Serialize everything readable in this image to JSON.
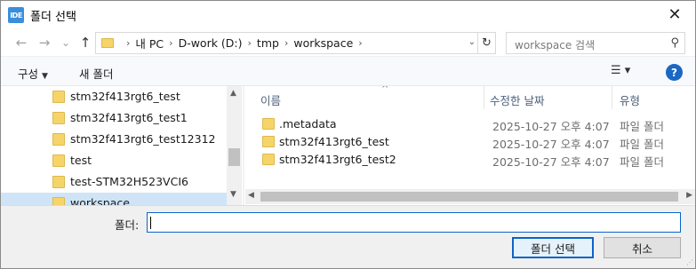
{
  "app": {
    "icon_text": "IDE",
    "title": "폴더 선택",
    "close_glyph": "✕"
  },
  "nav": {
    "back_glyph": "←",
    "forward_glyph": "→",
    "history_glyph": "⌄",
    "up_glyph": "↑",
    "breadcrumbs": [
      "내 PC",
      "D-work (D:)",
      "tmp",
      "workspace"
    ],
    "breadcrumb_sep": "›",
    "dropdown_glyph": "⌄",
    "refresh_glyph": "↻",
    "search_placeholder": "workspace 검색",
    "search_glyph": "⚲"
  },
  "toolbar": {
    "organize_label": "구성",
    "organize_caret": "▼",
    "new_folder_label": "새 폴더",
    "view_glyph": "☰ ▾",
    "help_glyph": "?"
  },
  "tree": {
    "items": [
      {
        "label": "stm32f413rgt6_test"
      },
      {
        "label": "stm32f413rgt6_test1"
      },
      {
        "label": "stm32f413rgt6_test12312"
      },
      {
        "label": "test"
      },
      {
        "label": "test-STM32H523VCI6"
      },
      {
        "label": "workspace",
        "selected": true
      }
    ],
    "scroll_up_glyph": "▲",
    "scroll_down_glyph": "▼"
  },
  "list": {
    "columns": {
      "name": "이름",
      "date": "수정한 날짜",
      "type": "유형"
    },
    "sort_glyph": "^",
    "rows": [
      {
        "name": ".metadata",
        "date": "2025-10-27 오후 4:07",
        "type": "파일 폴더"
      },
      {
        "name": "stm32f413rgt6_test",
        "date": "2025-10-27 오후 4:07",
        "type": "파일 폴더"
      },
      {
        "name": "stm32f413rgt6_test2",
        "date": "2025-10-27 오후 4:07",
        "type": "파일 폴더"
      }
    ],
    "scroll_left_glyph": "◀",
    "scroll_right_glyph": "▶"
  },
  "footer": {
    "folder_label": "폴더:",
    "folder_value": "",
    "select_button": "폴더 선택",
    "cancel_button": "취소",
    "grip_glyph": "⋰"
  }
}
